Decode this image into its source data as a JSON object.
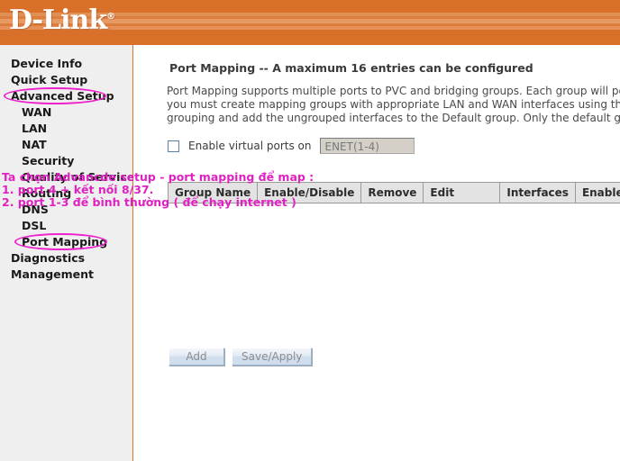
{
  "header": {
    "logo_text": "D-Link",
    "logo_registered": "®",
    "brand_color": "#d9702a"
  },
  "sidebar": {
    "items": [
      {
        "label": "Device Info",
        "level": 0,
        "circled": false
      },
      {
        "label": "Quick Setup",
        "level": 0,
        "circled": false
      },
      {
        "label": "Advanced Setup",
        "level": 0,
        "circled": true
      },
      {
        "label": "WAN",
        "level": 1,
        "circled": false
      },
      {
        "label": "LAN",
        "level": 1,
        "circled": false
      },
      {
        "label": "NAT",
        "level": 1,
        "circled": false
      },
      {
        "label": "Security",
        "level": 1,
        "circled": false
      },
      {
        "label": "Quality of Service",
        "level": 1,
        "circled": false
      },
      {
        "label": "Routing",
        "level": 1,
        "circled": false
      },
      {
        "label": "DNS",
        "level": 1,
        "circled": false
      },
      {
        "label": "DSL",
        "level": 1,
        "circled": false
      },
      {
        "label": "Port Mapping",
        "level": 1,
        "circled": true
      },
      {
        "label": "Diagnostics",
        "level": 0,
        "circled": false
      },
      {
        "label": "Management",
        "level": 0,
        "circled": false
      }
    ]
  },
  "main": {
    "title": "Port Mapping -- A maximum 16 entries can be configured",
    "description": "Port Mapping supports multiple ports to PVC and bridging groups. Each group will perform a\nyou must create mapping groups with appropriate LAN and WAN interfaces using the Add l\ngrouping and add the ungrouped interfaces to the Default group. Only the default group h",
    "enable_label": "Enable virtual ports on",
    "enable_checked": false,
    "enet_selected": "ENET(1-4)",
    "table": {
      "headers": [
        "Group Name",
        "Enable/Disable",
        "Remove",
        "Edit",
        "Interfaces",
        "Enable/Disable"
      ],
      "rows": []
    },
    "buttons": {
      "add": "Add",
      "save_apply": "Save/Apply"
    }
  },
  "annotation": {
    "color": "#e021c2",
    "lines": [
      "Ta chọn Advancde setup - port mapping để map :",
      "1. port 4 + kết nối 8/37.",
      "2. port 1-3 để bình thường ( để chạy internet )"
    ]
  }
}
